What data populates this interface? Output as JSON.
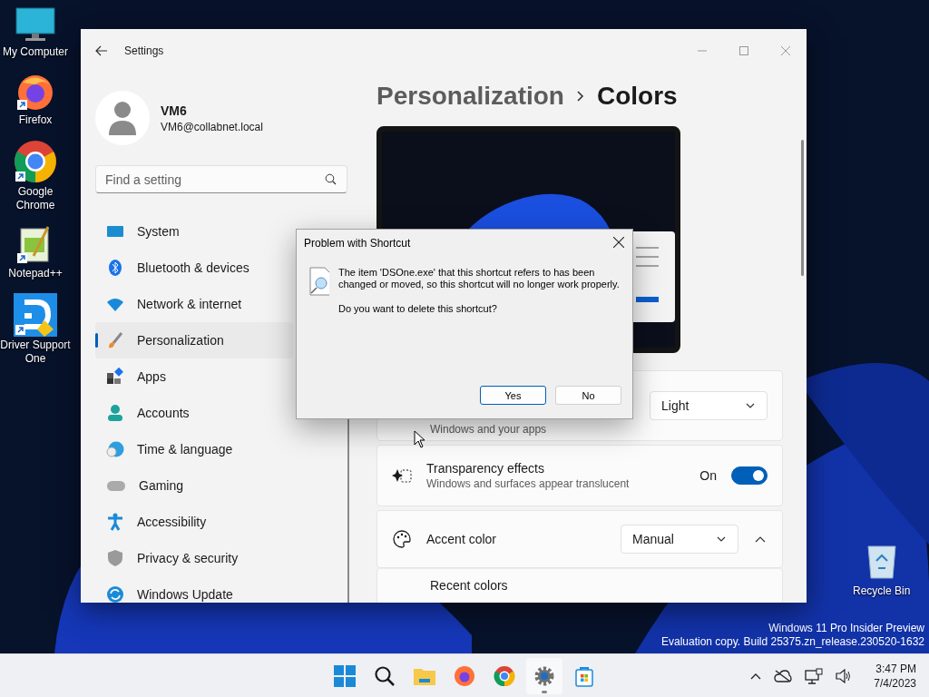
{
  "desktop_icons": [
    {
      "label": "My Computer",
      "shortcut": false
    },
    {
      "label": "Firefox",
      "shortcut": true
    },
    {
      "label": "Google Chrome",
      "shortcut": true
    },
    {
      "label": "Notepad++",
      "shortcut": true
    },
    {
      "label": "Driver Support One",
      "shortcut": true
    }
  ],
  "recycle_bin": {
    "label": "Recycle Bin"
  },
  "settings_window": {
    "title": "Settings",
    "profile": {
      "name": "VM6",
      "email": "VM6@collabnet.local"
    },
    "search": {
      "placeholder": "Find a setting"
    },
    "nav_items": [
      {
        "label": "System",
        "selected": false
      },
      {
        "label": "Bluetooth & devices",
        "selected": false
      },
      {
        "label": "Network & internet",
        "selected": false
      },
      {
        "label": "Personalization",
        "selected": true
      },
      {
        "label": "Apps",
        "selected": false
      },
      {
        "label": "Accounts",
        "selected": false
      },
      {
        "label": "Time & language",
        "selected": false
      },
      {
        "label": "Gaming",
        "selected": false
      },
      {
        "label": "Accessibility",
        "selected": false
      },
      {
        "label": "Privacy & security",
        "selected": false
      },
      {
        "label": "Windows Update",
        "selected": false
      }
    ],
    "breadcrumb": [
      "Personalization",
      "Colors"
    ],
    "cards": [
      {
        "kind": "dropdown",
        "subtitle": "Windows and your apps",
        "value": "Light"
      },
      {
        "kind": "toggle",
        "title": "Transparency effects",
        "subtitle": "Windows and surfaces appear translucent",
        "state_label": "On",
        "on": true
      },
      {
        "kind": "expander",
        "title": "Accent color",
        "value": "Manual",
        "expanded": true
      },
      {
        "kind": "section",
        "title": "Recent colors"
      }
    ]
  },
  "dialog": {
    "title": "Problem with Shortcut",
    "message": "The item 'DSOne.exe' that this shortcut refers to has been changed or moved, so this shortcut will no longer work properly.",
    "question": "Do you want to delete this shortcut?",
    "buttons": [
      {
        "label": "Yes",
        "default": true
      },
      {
        "label": "No",
        "default": false
      }
    ]
  },
  "watermark_lines": [
    "Windows 11 Pro Insider Preview",
    "Evaluation copy. Build 25375.zn_release.230520-1632"
  ],
  "taskbar": {
    "apps": [
      {
        "running": false
      },
      {
        "running": false
      },
      {
        "running": false
      },
      {
        "running": false
      },
      {
        "running": false
      },
      {
        "running": true
      },
      {
        "running": false
      }
    ],
    "time": "3:47 PM",
    "date": "7/4/2023"
  }
}
